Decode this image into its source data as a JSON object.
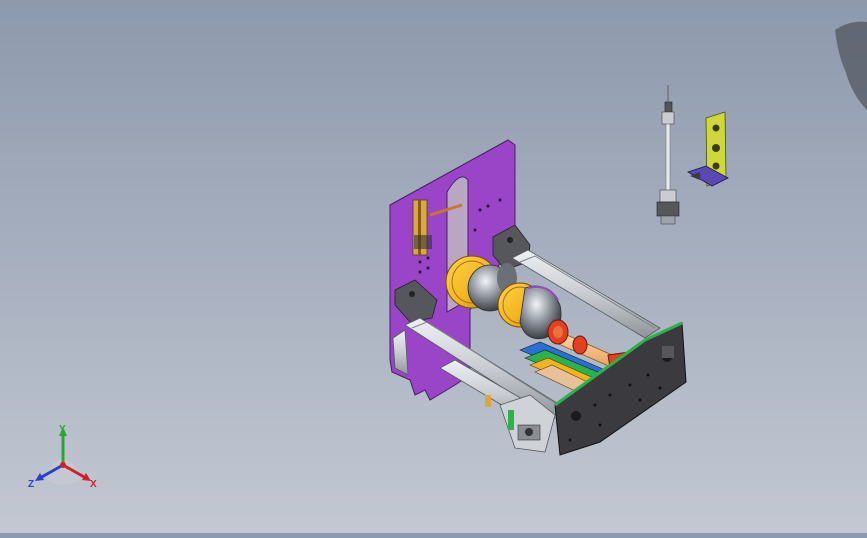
{
  "viewport": {
    "background_top": "#8d99ac",
    "background_bottom": "#c3c8d2"
  },
  "model": {
    "plate_color": "#9a45c8",
    "rail_color": "#c9cdd3",
    "end_plate_color": "#3b3b3f",
    "cup_color": "#f2b41e",
    "dome_color": "#9da3ab",
    "accent_red": "#e2401e",
    "accent_green": "#2bb24a",
    "bracket_color": "#cfd83a"
  },
  "triad": {
    "x_label": "X",
    "y_label": "Y",
    "z_label": "Z",
    "x_color": "#d0202a",
    "y_color": "#2aa536",
    "z_color": "#2a3fd0"
  }
}
